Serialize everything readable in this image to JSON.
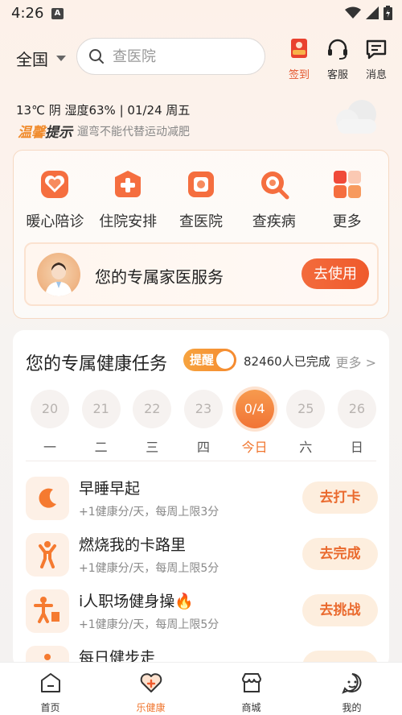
{
  "status_bar": {
    "time": "4:26",
    "app_badge": "A"
  },
  "header": {
    "region": "全国",
    "search_placeholder": "查医院",
    "buttons": [
      {
        "id": "signin",
        "label": "签到",
        "icon": "signin-gift-icon"
      },
      {
        "id": "service",
        "label": "客服",
        "icon": "headset-icon"
      },
      {
        "id": "messages",
        "label": "消息",
        "icon": "message-icon"
      }
    ]
  },
  "weather": {
    "line": "13℃  阴  湿度63%  |  01/24  周五",
    "tip_tag_a": "温馨",
    "tip_tag_b": "提示",
    "tip_text": "遛弯不能代替运动减肥"
  },
  "services": [
    {
      "label": "暖心陪诊",
      "icon": "heart-shield-icon"
    },
    {
      "label": "住院安排",
      "icon": "hospital-plus-icon"
    },
    {
      "label": "查医院",
      "icon": "hospital-search-icon"
    },
    {
      "label": "查疾病",
      "icon": "disease-search-icon"
    },
    {
      "label": "更多",
      "icon": "grid-more-icon"
    }
  ],
  "doctor_banner": {
    "title": "您的专属家医服务",
    "button": "去使用"
  },
  "tasks_section": {
    "title": "您的专属健康任务",
    "remind_label": "提醒",
    "completed": "82460人已完成",
    "more": "更多 >",
    "week": [
      {
        "num": "20",
        "weekday": "一",
        "today": false
      },
      {
        "num": "21",
        "weekday": "二",
        "today": false
      },
      {
        "num": "22",
        "weekday": "三",
        "today": false
      },
      {
        "num": "23",
        "weekday": "四",
        "today": false
      },
      {
        "num": "0/4",
        "weekday": "今日",
        "today": true
      },
      {
        "num": "25",
        "weekday": "六",
        "today": false
      },
      {
        "num": "26",
        "weekday": "日",
        "today": false
      }
    ],
    "tasks": [
      {
        "name": "早睡早起",
        "desc": "+1健康分/天，每周上限3分",
        "button": "去打卡",
        "icon": "moon-icon"
      },
      {
        "name": "燃烧我的卡路里",
        "desc": "+1健康分/天，每周上限5分",
        "button": "去完成",
        "icon": "exercise-person-icon"
      },
      {
        "name": "i人职场健身操🔥",
        "desc": "+1健康分/天，每周上限5分",
        "button": "去挑战",
        "icon": "office-workout-icon"
      },
      {
        "name": "每日健步走",
        "desc": "",
        "button": "",
        "icon": "walking-icon"
      }
    ]
  },
  "bottom_nav": [
    {
      "label": "首页",
      "icon": "home-icon",
      "active": false
    },
    {
      "label": "乐健康",
      "icon": "health-heart-icon",
      "active": true
    },
    {
      "label": "商城",
      "icon": "store-icon",
      "active": false
    },
    {
      "label": "我的",
      "icon": "profile-icon",
      "active": false
    }
  ],
  "colors": {
    "accent": "#f0762f",
    "accent_red": "#ef5a2c",
    "soft_orange": "#fdeede"
  }
}
